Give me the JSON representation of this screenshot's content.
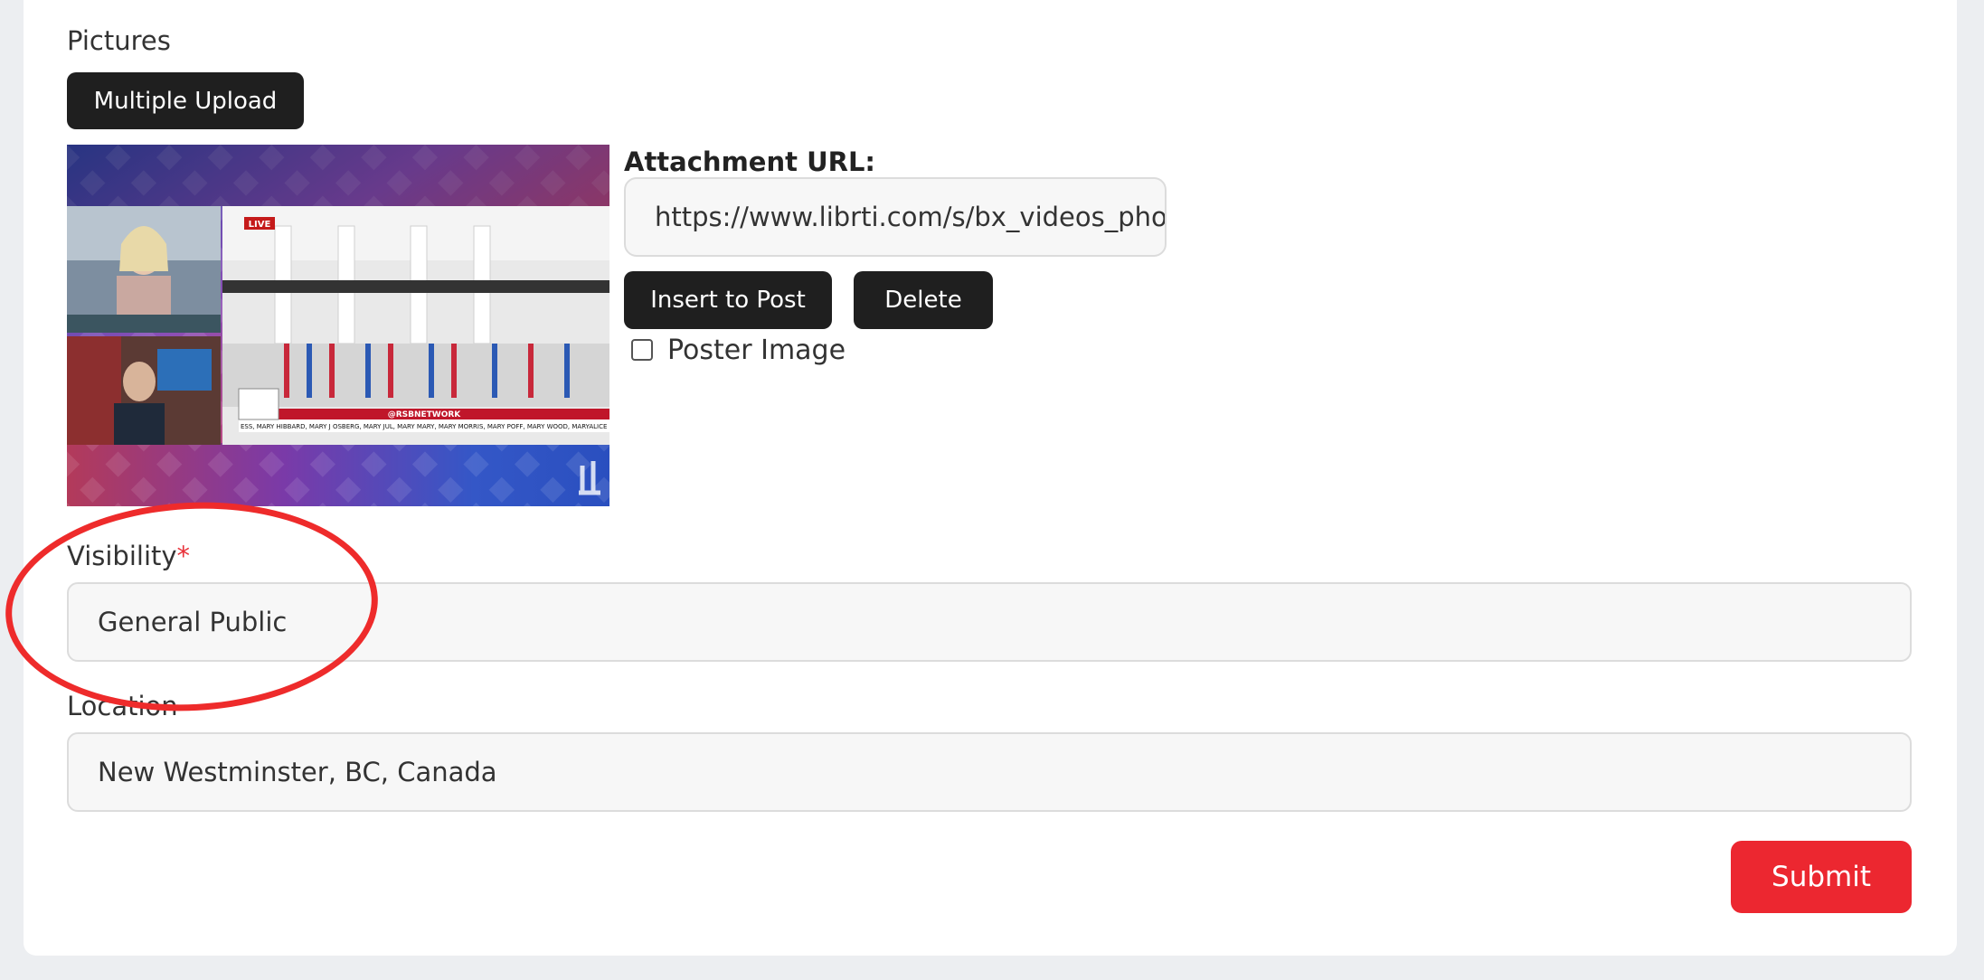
{
  "pictures": {
    "label": "Pictures",
    "multiple_upload_label": "Multiple Upload"
  },
  "attachment": {
    "url_label": "Attachment URL:",
    "url_value": "https://www.librti.com/s/bx_videos_photo",
    "insert_label": "Insert to Post",
    "delete_label": "Delete",
    "poster_image_label": "Poster Image",
    "poster_image_checked": false,
    "thumbnail": {
      "live_badge": "LIVE",
      "ticker_handle": "@RSBNETWORK",
      "ticker_text": "ESS, MARY HIBBARD, MARY J OSBERG, MARY JUL, MARY MARY, MARY MORRIS, MARY POFF, MARY WOOD, MARYALICE"
    }
  },
  "visibility": {
    "label": "Visibility",
    "required_mark": "*",
    "value": "General Public"
  },
  "location": {
    "label": "Location",
    "value": "New Westminster, BC, Canada"
  },
  "submit_label": "Submit",
  "colors": {
    "accent": "#ec2730",
    "dark_button": "#1f1f1f",
    "annotation_circle": "#ee2b2b"
  }
}
